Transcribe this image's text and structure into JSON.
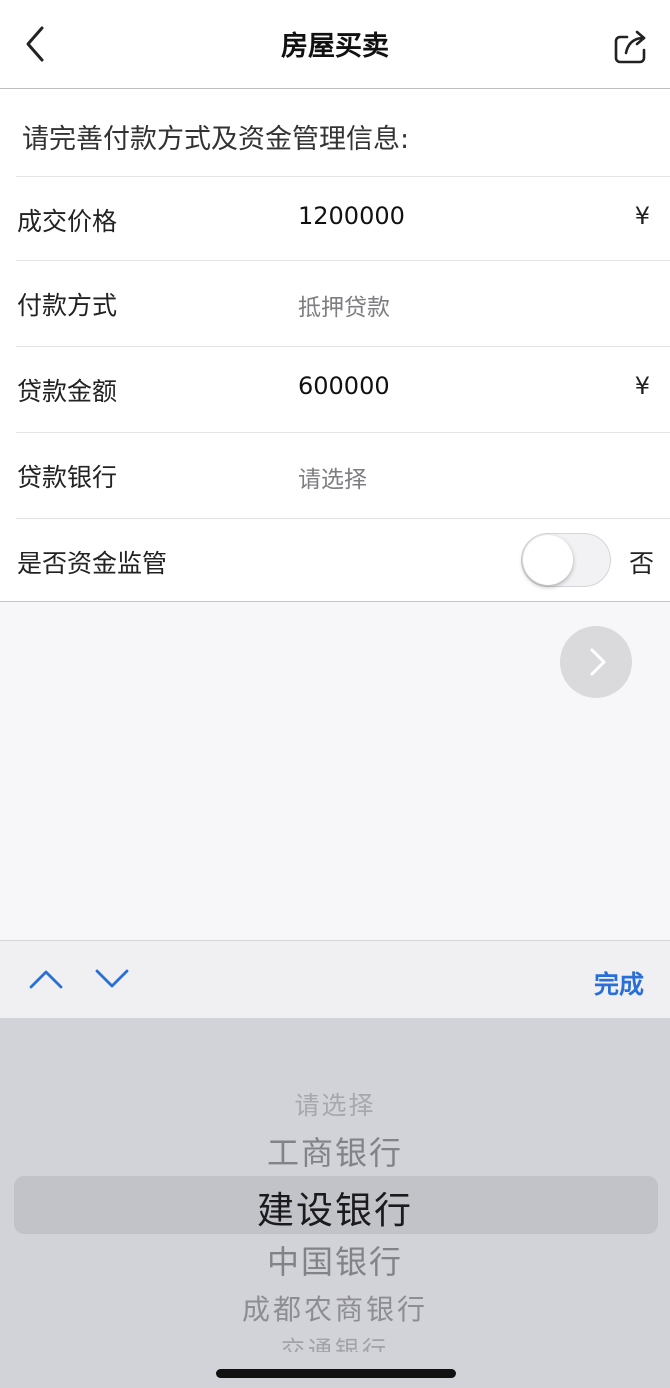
{
  "nav": {
    "title": "房屋买卖"
  },
  "form": {
    "section_title": "请完善付款方式及资金管理信息:",
    "rows": [
      {
        "label": "成交价格",
        "value": "1200000",
        "unit": "¥"
      },
      {
        "label": "付款方式",
        "placeholder": "抵押贷款"
      },
      {
        "label": "贷款金额",
        "value": "600000",
        "unit": "¥"
      },
      {
        "label": "贷款银行",
        "placeholder": "请选择"
      },
      {
        "label": "是否资金监管",
        "toggle_on": false,
        "toggle_text": "否"
      }
    ]
  },
  "toolbar": {
    "done_label": "完成"
  },
  "picker": {
    "options": [
      "请选择",
      "工商银行",
      "建设银行",
      "中国银行",
      "成都农商银行",
      "交通银行"
    ],
    "selected": "建设银行"
  },
  "colors": {
    "accent": "#2a6fd6",
    "picker_bg": "#d2d3d8"
  }
}
